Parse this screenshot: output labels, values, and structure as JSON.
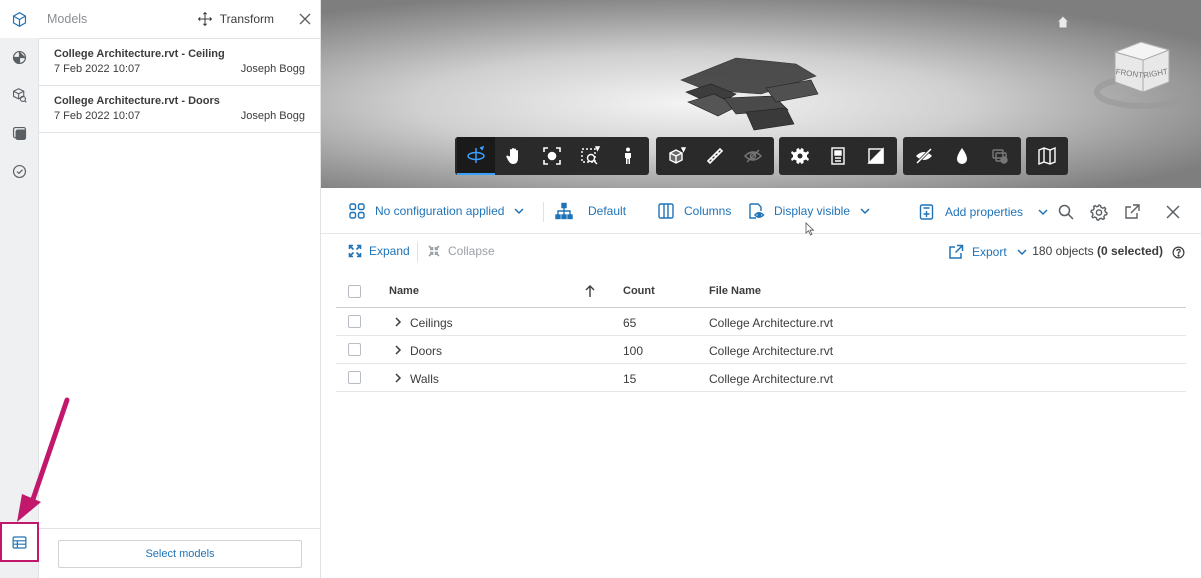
{
  "models_panel": {
    "title": "Models",
    "transform_label": "Transform",
    "items": [
      {
        "name": "College Architecture.rvt - Ceiling",
        "date": "7 Feb 2022 10:07",
        "user": "Joseph Bogg"
      },
      {
        "name": "College Architecture.rvt - Doors",
        "date": "7 Feb 2022 10:07",
        "user": "Joseph Bogg"
      }
    ],
    "select_models_label": "Select models"
  },
  "viewer": {
    "viewcube_labels": {
      "front": "FRONT",
      "right": "RIGHT"
    }
  },
  "table_toolbar": {
    "configuration": "No configuration applied",
    "grouping": "Default",
    "columns": "Columns",
    "display": "Display visible",
    "add_properties": "Add properties",
    "expand": "Expand",
    "collapse": "Collapse",
    "export": "Export",
    "objects_total": "180 objects",
    "objects_selected": "(0 selected)"
  },
  "table": {
    "columns": [
      "Name",
      "Count",
      "File Name"
    ],
    "rows": [
      {
        "name": "Ceilings",
        "count": "65",
        "file": "College Architecture.rvt"
      },
      {
        "name": "Doors",
        "count": "100",
        "file": "College Architecture.rvt"
      },
      {
        "name": "Walls",
        "count": "15",
        "file": "College Architecture.rvt"
      }
    ]
  },
  "colors": {
    "accent": "#1f73b7",
    "annotation": "#c2186b",
    "toolbar_bg": "#2a2a2a"
  }
}
